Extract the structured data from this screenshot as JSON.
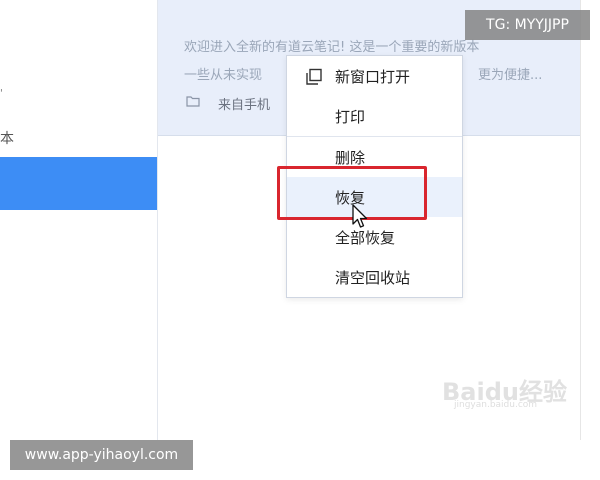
{
  "sidebar": {
    "items": [
      {
        "label": "本"
      }
    ]
  },
  "note_preview": {
    "line1": "欢迎进入全新的有道云笔记! 这是一个重要的新版本",
    "line2_left": "一些从未实现",
    "line2_right": "更为便捷...",
    "source_icon": "folder-icon",
    "source_label": "来自手机"
  },
  "context_menu": {
    "items": [
      {
        "label": "新窗口打开",
        "icon": "new-window-icon"
      },
      {
        "label": "打印"
      },
      {
        "label": "删除"
      },
      {
        "label": "恢复",
        "highlighted": true
      },
      {
        "label": "全部恢复"
      },
      {
        "label": "清空回收站"
      }
    ]
  },
  "overlays": {
    "tg_label": "TG: MYYJJPP",
    "url_label": "www.app-yihaoyl.com",
    "logo_text": "Baidu经验",
    "logo_sub": "jingyan.baidu.com"
  },
  "colors": {
    "selection_blue": "#3d8df5",
    "highlight_red": "#d9262e",
    "preview_bg": "#e8eefa"
  }
}
